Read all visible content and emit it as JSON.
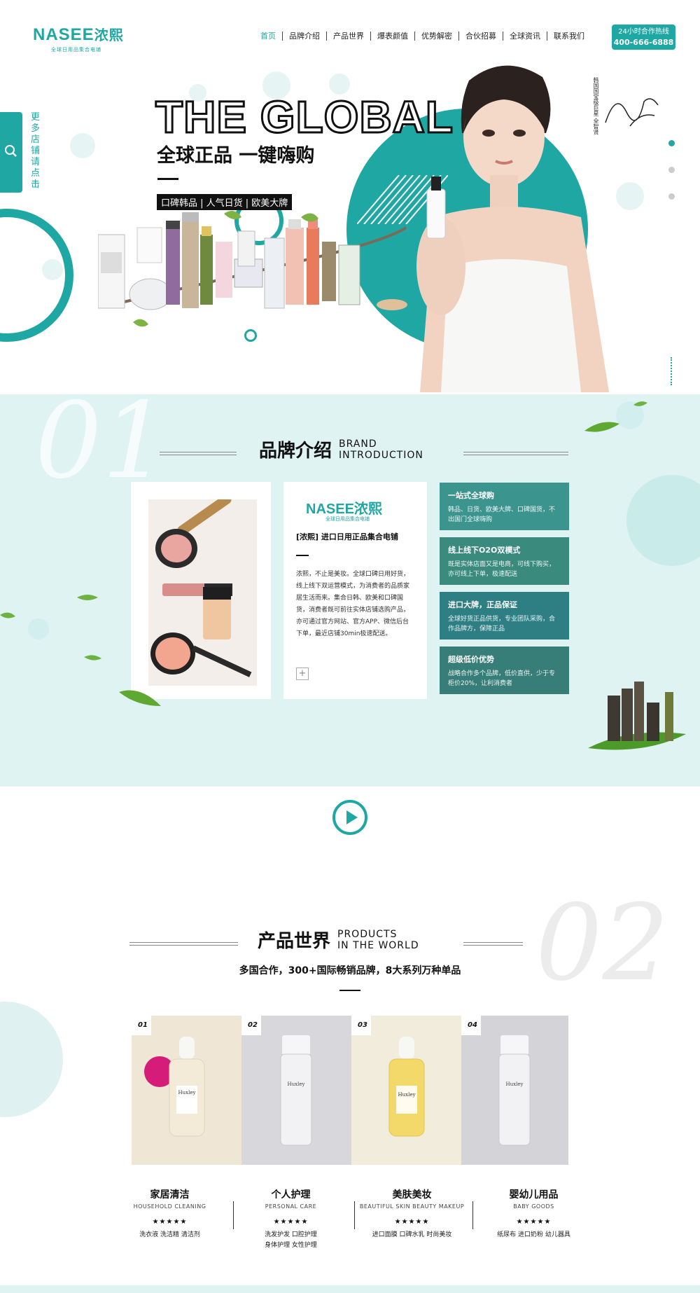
{
  "header": {
    "logo_main": "NASEE",
    "logo_cn": "浓熙",
    "logo_sub": "全球日用品集合电铺",
    "nav": [
      "首页",
      "品牌介绍",
      "产品世界",
      "爆表颜值",
      "优势解密",
      "合伙招募",
      "全球资讯",
      "联系我们"
    ],
    "hotline_label": "24小时合作热线",
    "hotline_number": "400-666-6888"
  },
  "side_search": {
    "label": "更多店铺请点击",
    "icon": "search-icon"
  },
  "hero": {
    "title": "THE GLOBAL",
    "subtitle": "全球正品 一键嗨购",
    "tags": "口碑韩品 | 人气日货 | 欧美大牌",
    "side_text": "韩国国宝级巨星 全智贤",
    "slides": 3,
    "active_slide": 1
  },
  "brand": {
    "number": "01",
    "title_cn": "品牌介绍",
    "title_en_1": "BRAND",
    "title_en_2": "INTRODUCTION",
    "card_logo": "NASEE浓熙",
    "card_logo_sub": "全球日用品集合电铺",
    "card_title": "[浓熙] 进口日用正品集合电铺",
    "card_desc": "浓熙，不止是美妆。全球口碑日用好货，线上线下双运营模式，为消费者的品质家居生活而来。集合日韩、欧美和口碑国货，消费者既可前往实体店铺选购产品，亦可通过官方网站、官方APP、微信后台下单，最近店铺30min极速配送。",
    "card_more": "+",
    "features": [
      {
        "title": "一站式全球购",
        "desc": "韩品、日货、欧美大牌、口碑国货，不出国门全球嗨购"
      },
      {
        "title": "线上线下O2O双模式",
        "desc": "既是实体店面又是电商，可线下购买，亦可线上下单，极速配送"
      },
      {
        "title": "进口大牌，正品保证",
        "desc": "全球好货正品供货，专业团队采购，合作品牌方，保障正品"
      },
      {
        "title": "超级低价优势",
        "desc": "战略合作多个品牌，低价直供，少于专柜价20%，让利消费者"
      }
    ]
  },
  "video": {
    "icon": "play-icon"
  },
  "products": {
    "number": "02",
    "title_cn": "产品世界",
    "title_en_1": "PRODUCTS",
    "title_en_2": "IN THE WORLD",
    "subtitle": "多国合作，300+国际畅销品牌，8大系列万种单品",
    "tiles": [
      {
        "num": "01",
        "bg": "#efe6d6",
        "bottle": "#f4ead8",
        "label": "Huxley"
      },
      {
        "num": "02",
        "bg": "#d8d8dc",
        "bottle": "#f2f2f4",
        "label": "Huxley"
      },
      {
        "num": "03",
        "bg": "#f1ecdb",
        "bottle": "#f2d96a",
        "label": "Huxley"
      },
      {
        "num": "04",
        "bg": "#d4d4d8",
        "bottle": "#f2f2f4",
        "label": "Huxley"
      }
    ],
    "categories": [
      {
        "name": "家居清洁",
        "en": "HOUSEHOLD CLEANING",
        "stars": "★★★★★",
        "items_1": "洗衣液  洗洁精  清洁剂",
        "items_2": ""
      },
      {
        "name": "个人护理",
        "en": "PERSONAL CARE",
        "stars": "★★★★★",
        "items_1": "洗发护发  口腔护理",
        "items_2": "身体护理  女性护理"
      },
      {
        "name": "美肤美妆",
        "en": "BEAUTIFUL SKIN BEAUTY MAKEUP",
        "stars": "★★★★★",
        "items_1": "进口面膜  口碑水乳  时尚美妆",
        "items_2": ""
      },
      {
        "name": "婴幼儿用品",
        "en": "BABY GOODS",
        "stars": "★★★★★",
        "items_1": "纸尿布  进口奶粉  幼儿器具",
        "items_2": ""
      }
    ]
  },
  "colors": {
    "accent": "#1fa7a3",
    "brand_bg": "#dff3f3",
    "feature_bg": "#2f8c88"
  }
}
